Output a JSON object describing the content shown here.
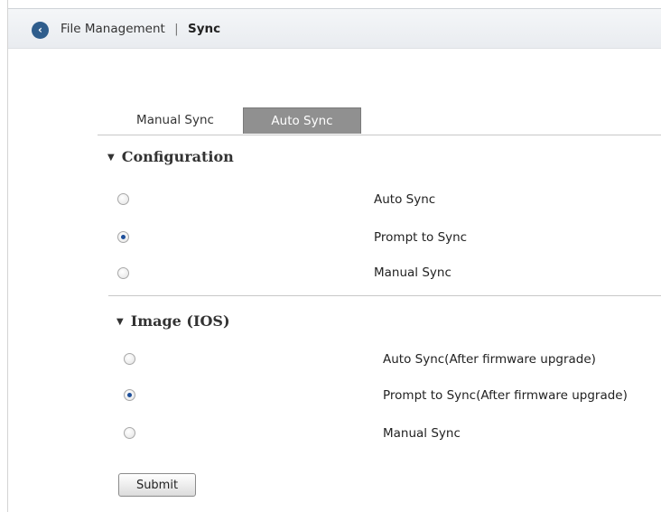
{
  "header": {
    "back_icon": "chevron-left-icon",
    "breadcrumb_parent": "File Management",
    "separator": "|",
    "breadcrumb_current": "Sync"
  },
  "tabs": [
    {
      "label": "Manual Sync",
      "active": false
    },
    {
      "label": "Auto Sync",
      "active": true
    }
  ],
  "configuration": {
    "title": "Configuration",
    "options": [
      {
        "label": "Auto Sync",
        "checked": false
      },
      {
        "label": "Prompt to Sync",
        "checked": true
      },
      {
        "label": "Manual Sync",
        "checked": false
      }
    ]
  },
  "image": {
    "title": "Image (IOS)",
    "options": [
      {
        "label": "Auto Sync(After firmware upgrade)",
        "checked": false
      },
      {
        "label": "Prompt to Sync(After firmware upgrade)",
        "checked": true
      },
      {
        "label": "Manual Sync",
        "checked": false
      }
    ]
  },
  "submit_label": "Submit",
  "colors": {
    "active_tab_bg": "#909090",
    "radio_dot": "#1e4f9a",
    "back_button": "#2f5d8c"
  }
}
